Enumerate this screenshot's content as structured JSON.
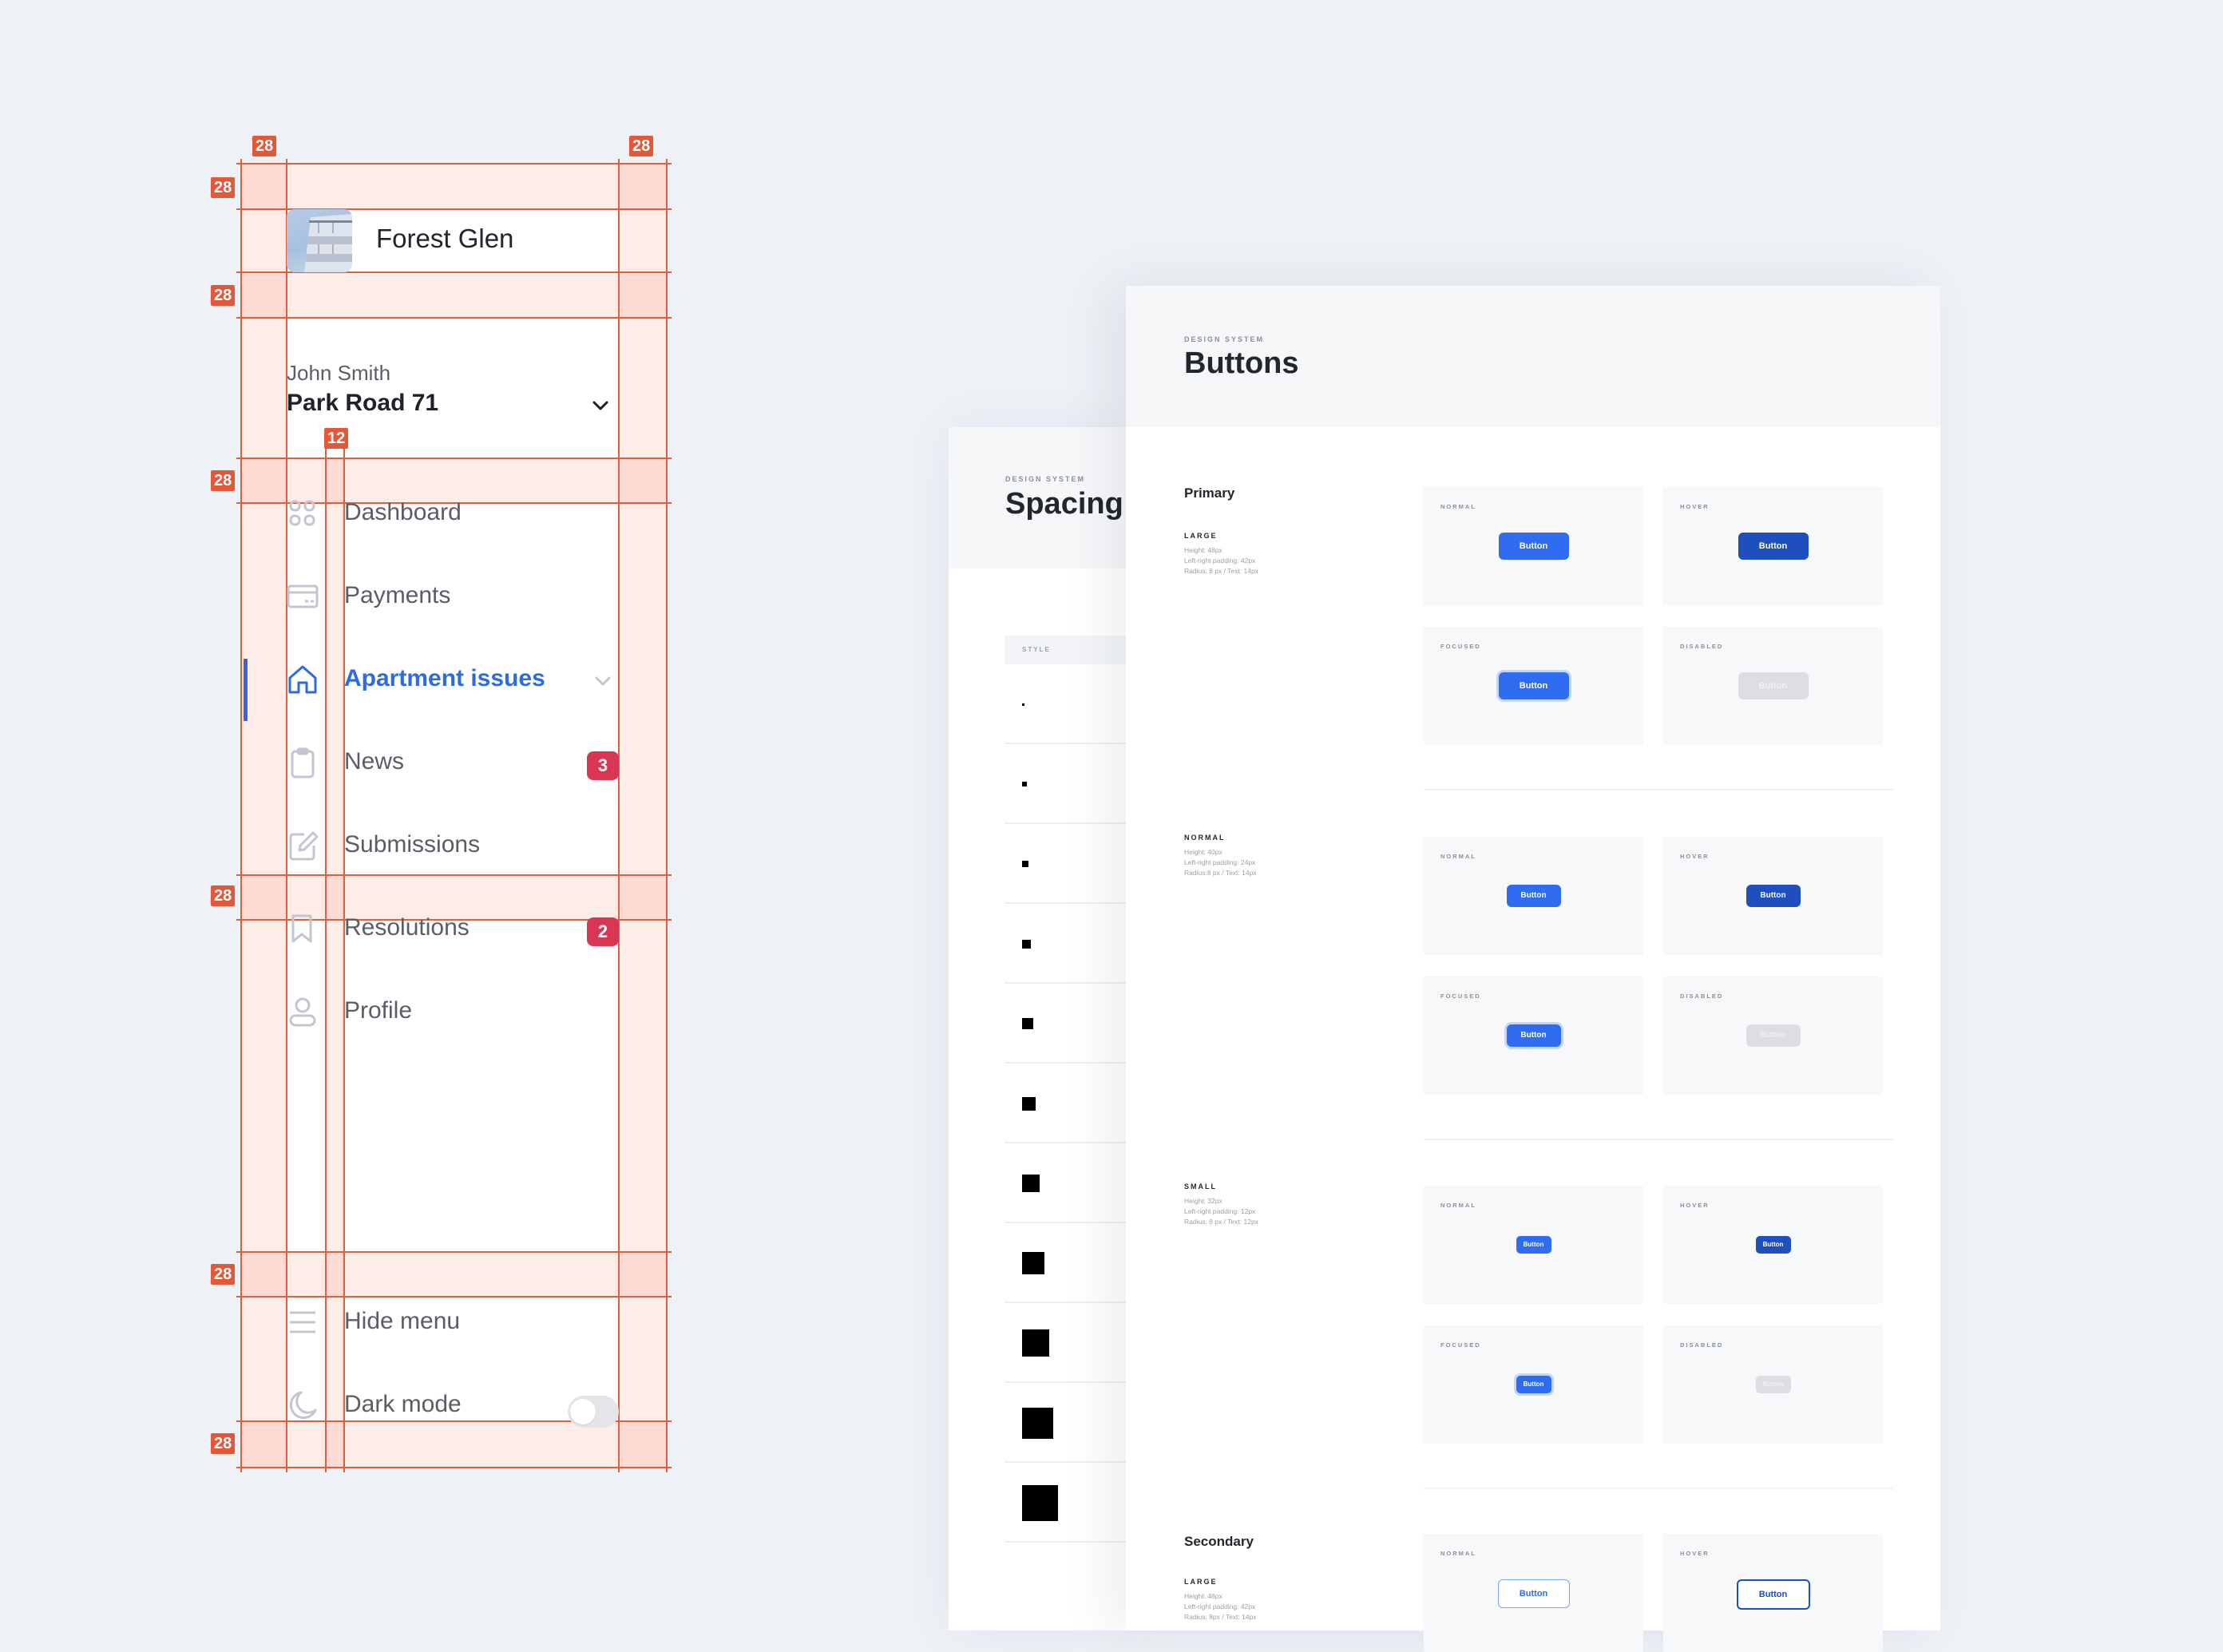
{
  "sidebar": {
    "brand": {
      "name": "Forest Glen",
      "image": "building-photo"
    },
    "account": {
      "user_name": "John Smith",
      "address": "Park Road 71"
    },
    "nav": [
      {
        "label": "Dashboard",
        "icon": "grid-icon",
        "active": false,
        "badge": null
      },
      {
        "label": "Payments",
        "icon": "credit-card-icon",
        "active": false,
        "badge": null
      },
      {
        "label": "Apartment issues",
        "icon": "home-icon",
        "active": true,
        "badge": null,
        "expandable": true
      },
      {
        "label": "News",
        "icon": "clipboard-icon",
        "active": false,
        "badge": "3"
      },
      {
        "label": "Submissions",
        "icon": "edit-icon",
        "active": false,
        "badge": null
      },
      {
        "label": "Resolutions",
        "icon": "bookmark-icon",
        "active": false,
        "badge": "2"
      },
      {
        "label": "Profile",
        "icon": "user-icon",
        "active": false,
        "badge": null
      }
    ],
    "footer": [
      {
        "label": "Hide menu",
        "icon": "menu-icon"
      },
      {
        "label": "Dark mode",
        "icon": "moon-icon",
        "toggle": false
      }
    ],
    "colors": {
      "accent": "#2d6bde",
      "badge": "#d93654",
      "text": "#5a5d66"
    }
  },
  "spec_overlay": {
    "labels": {
      "outer": "28",
      "icon_gap": "12"
    },
    "color": "#e4583a"
  },
  "spacing_panel": {
    "eyebrow": "DESIGN SYSTEM",
    "title": "Spacing",
    "table_header": "STYLE",
    "swatches": [
      2,
      4,
      6,
      8,
      10,
      12,
      16,
      20,
      24,
      28,
      32
    ]
  },
  "buttons_panel": {
    "eyebrow": "DESIGN SYSTEM",
    "title": "Buttons",
    "groups": [
      {
        "title": "Primary",
        "sizes": [
          {
            "label": "LARGE",
            "desc": "Height: 48px\nLeft-right padding: 42px\nRadius: 8 px / Text: 14px",
            "states": [
              {
                "label": "NORMAL",
                "button": "Button"
              },
              {
                "label": "HOVER",
                "button": "Button"
              },
              {
                "label": "FOCUSED",
                "button": "Button"
              },
              {
                "label": "DISABLED",
                "button": "Button"
              }
            ]
          },
          {
            "label": "NORMAL",
            "desc": "Height: 40px\nLeft-right padding: 24px\nRadius:8 px / Text: 14px",
            "states": [
              {
                "label": "NORMAL",
                "button": "Button"
              },
              {
                "label": "HOVER",
                "button": "Button"
              },
              {
                "label": "FOCUSED",
                "button": "Button"
              },
              {
                "label": "DISABLED",
                "button": "Button"
              }
            ]
          },
          {
            "label": "SMALL",
            "desc": "Height: 32px\nLeft-right padding: 12px\nRadius: 8 px / Text: 12px",
            "states": [
              {
                "label": "NORMAL",
                "button": "Button"
              },
              {
                "label": "HOVER",
                "button": "Button"
              },
              {
                "label": "FOCUSED",
                "button": "Button"
              },
              {
                "label": "DISABLED",
                "button": "Button"
              }
            ]
          }
        ]
      },
      {
        "title": "Secondary",
        "sizes": [
          {
            "label": "LARGE",
            "desc": "Height: 48px\nLeft-right padding: 42px\nRadius: 8px / Text: 14px",
            "states": [
              {
                "label": "NORMAL",
                "button": "Button"
              },
              {
                "label": "HOVER",
                "button": "Button"
              }
            ]
          }
        ]
      }
    ],
    "colors": {
      "primary": "#2f6cef",
      "hover": "#1f4fbf",
      "focus_ring": "#c5d6fb",
      "disabled": "#dcdee3"
    }
  }
}
